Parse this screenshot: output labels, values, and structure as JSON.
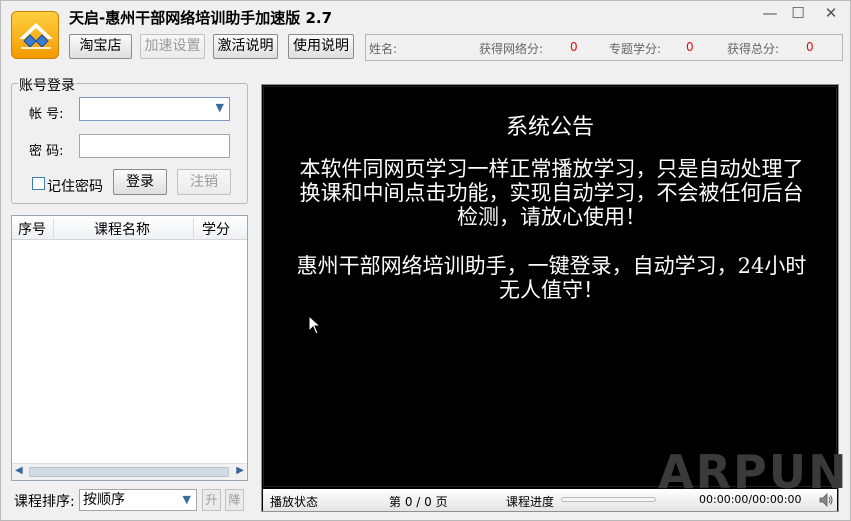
{
  "window": {
    "title": "天启-惠州干部网络培训助手加速版 2.7",
    "controls": {
      "minimize": "—",
      "maximize": "☐",
      "close": "✕"
    }
  },
  "toolbar": {
    "taobao_label": "淘宝店",
    "speed_settings_label": "加速设置",
    "activation_help_label": "激活说明",
    "usage_help_label": "使用说明"
  },
  "stats": {
    "name_label": "姓名:",
    "name_value": "",
    "network_credit_label": "获得网络分:",
    "network_credit_value": "0",
    "topic_credit_label": "专题学分:",
    "topic_credit_value": "0",
    "total_credit_label": "获得总分:",
    "total_credit_value": "0"
  },
  "login": {
    "group_title": "账号登录",
    "account_label": "帐  号:",
    "account_value": "",
    "password_label": "密  码:",
    "password_value": "",
    "remember_label": "记住密码",
    "remember_checked": false,
    "login_label": "登录",
    "logout_label": "注销"
  },
  "course_list": {
    "columns": [
      "序号",
      "课程名称",
      "学分"
    ],
    "rows": []
  },
  "sort": {
    "label": "课程排序:",
    "selected": "按顺序",
    "up_label": "升",
    "down_label": "降"
  },
  "player": {
    "notice_title": "系统公告",
    "notice_paragraph1": "本软件同网页学习一样正常播放学习，只是自动处理了换课和中间点击功能，实现自动学习，不会被任何后台检测，请放心使用！",
    "notice_paragraph2": "惠州干部网络培训助手，一键登录，自动学习，24小时无人值守！",
    "watermark": "ARPUN",
    "status_label": "播放状态",
    "page_indicator": "第 0 / 0 页",
    "progress_label": "课程进度",
    "progress_fraction": 0,
    "time": "00:00:00/00:00:00"
  }
}
